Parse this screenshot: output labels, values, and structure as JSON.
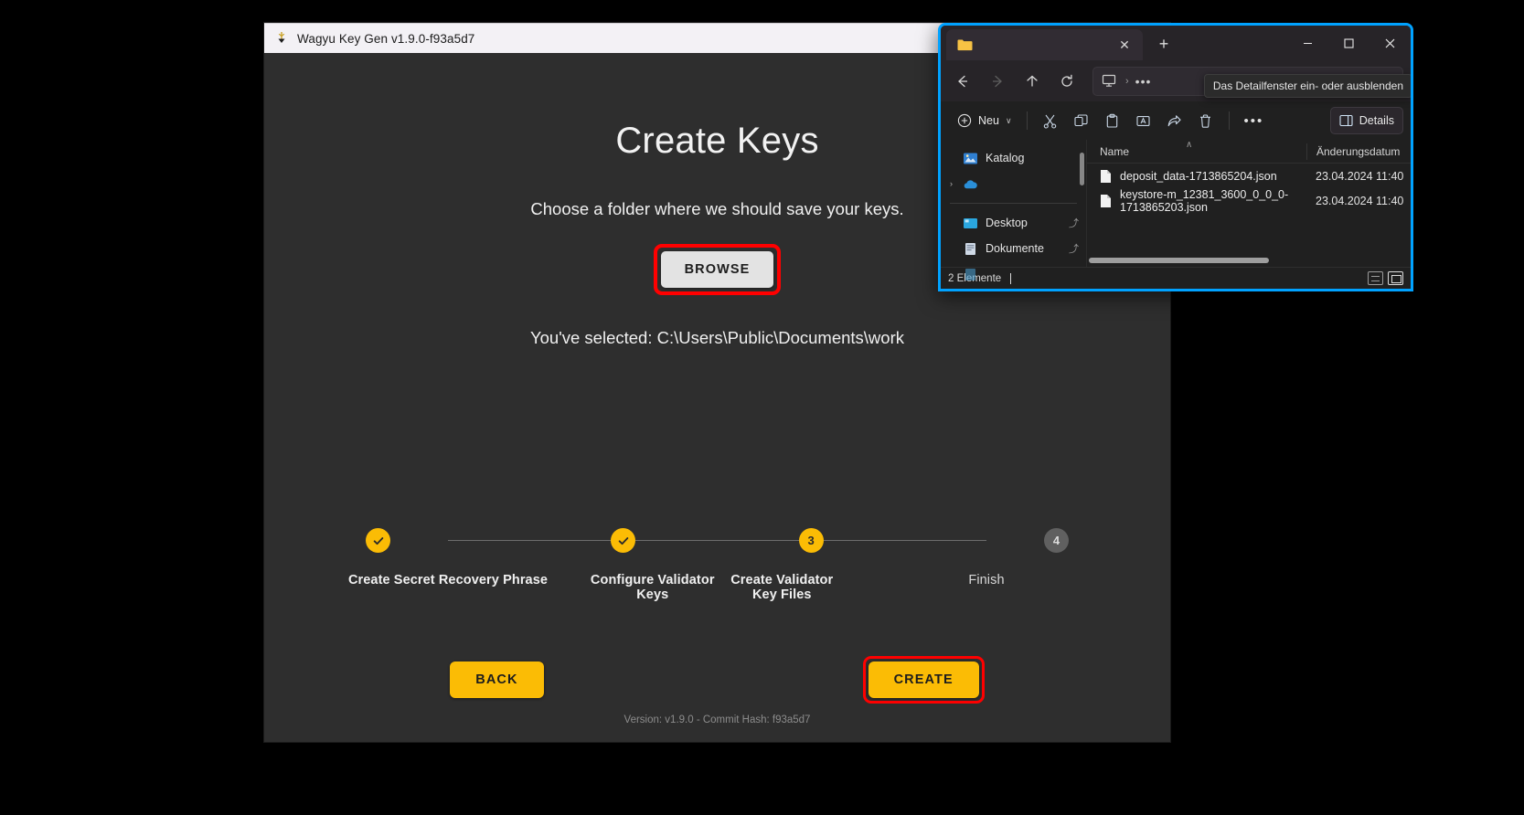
{
  "wagyu": {
    "title": "Wagyu Key Gen v1.9.0-f93a5d7",
    "heading": "Create Keys",
    "subtitle": "Choose a folder where we should save your keys.",
    "browse_label": "BROWSE",
    "selected_path_text": "You've selected: C:\\Users\\Public\\Documents\\work",
    "back_label": "BACK",
    "create_label": "CREATE",
    "version_line": "Version: v1.9.0 - Commit Hash: f93a5d7",
    "accent_amber": "#fbbc05",
    "highlight_red": "#ff0000",
    "steps": [
      {
        "marker": "check",
        "label": "Create Secret Recovery Phrase",
        "state": "done"
      },
      {
        "marker": "check",
        "label": "Configure Validator Keys",
        "state": "done"
      },
      {
        "marker": "3",
        "label": "Create Validator Key Files",
        "state": "active"
      },
      {
        "marker": "4",
        "label": "Finish",
        "state": "todo"
      }
    ]
  },
  "explorer": {
    "highlight_border_color": "#00a2ff",
    "tab": {
      "icon": "folder-icon",
      "close_glyph": "✕"
    },
    "new_tab_glyph": "+",
    "caption": {
      "minimize": "—",
      "maximize": "☐",
      "close": "✕"
    },
    "nav": {
      "back": "←",
      "forward": "→",
      "up": "↑",
      "refresh": "↻",
      "address_chevron": "›",
      "address_dots": "•••"
    },
    "toolbar": {
      "new_label": "Neu",
      "new_chevron": "∨",
      "cut": "cut-icon",
      "copy": "copy-icon",
      "paste": "paste-icon",
      "rename": "rename-icon",
      "share": "share-icon",
      "delete": "delete-icon",
      "overflow": "•••",
      "details_label": "Details"
    },
    "tooltip": "Das Detailfenster ein- oder ausblenden",
    "sidebar": [
      {
        "label": "Katalog",
        "icon": "gallery-icon",
        "chevron": "",
        "pin": ""
      },
      {
        "label": "",
        "icon": "onedrive-icon",
        "chevron": "›",
        "pin": ""
      },
      {
        "label": "Desktop",
        "icon": "desktop-icon",
        "chevron": "",
        "pin": "⤴"
      },
      {
        "label": "Dokumente",
        "icon": "documents-icon",
        "chevron": "",
        "pin": "⤴"
      }
    ],
    "columns": {
      "name": "Name",
      "date": "Änderungsdatum",
      "sort_caret": "∧"
    },
    "files": [
      {
        "name": "deposit_data-1713865204.json",
        "date": "23.04.2024 11:40",
        "icon": "json-file-icon"
      },
      {
        "name": "keystore-m_12381_3600_0_0_0-1713865203.json",
        "date": "23.04.2024 11:40",
        "icon": "json-file-icon"
      }
    ],
    "status": {
      "item_count": "2 Elemente"
    }
  }
}
